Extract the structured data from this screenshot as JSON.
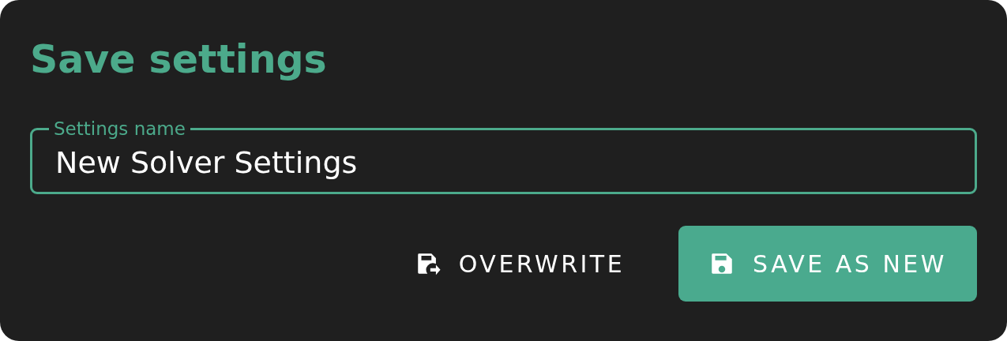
{
  "dialog": {
    "title": "Save settings"
  },
  "field": {
    "label": "Settings name",
    "value": "New Solver Settings"
  },
  "buttons": [
    {
      "label": "OVERWRITE",
      "kind": "text"
    },
    {
      "label": "SAVE AS NEW",
      "kind": "contained"
    }
  ]
}
